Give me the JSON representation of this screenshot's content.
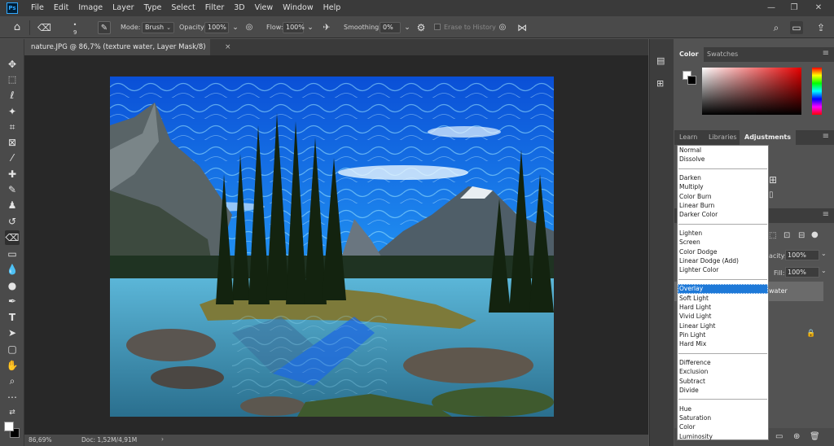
{
  "app": {
    "logo_text": "Ps"
  },
  "menu": [
    "File",
    "Edit",
    "Image",
    "Layer",
    "Type",
    "Select",
    "Filter",
    "3D",
    "View",
    "Window",
    "Help"
  ],
  "window_controls": {
    "minimize": "—",
    "restore": "❐",
    "close": "✕"
  },
  "options": {
    "brush_size": "9",
    "mode_label": "Mode:",
    "mode_value": "Brush",
    "opacity_label": "Opacity:",
    "opacity_value": "100%",
    "flow_label": "Flow:",
    "flow_value": "100%",
    "smoothing_label": "Smoothing:",
    "smoothing_value": "0%",
    "erase_history_label": "Erase to History"
  },
  "document": {
    "tab_title": "nature.JPG @ 86,7% (texture water, Layer Mask/8) *",
    "close_glyph": "×"
  },
  "status": {
    "zoom": "86,69%",
    "doc_info": "Doc: 1,52M/4,91M",
    "arrow": "›"
  },
  "panels": {
    "color_tabs": [
      "Color",
      "Swatches"
    ],
    "adjust_tabs": [
      "Learn",
      "Libraries",
      "Adjustments"
    ],
    "layers": {
      "opacity_label": "acity:",
      "opacity_value": "100%",
      "fill_label": "Fill:",
      "fill_value": "100%",
      "layer_name": "water"
    }
  },
  "blend_modes": [
    [
      "Normal",
      "Dissolve"
    ],
    [
      "Darken",
      "Multiply",
      "Color Burn",
      "Linear Burn",
      "Darker Color"
    ],
    [
      "Lighten",
      "Screen",
      "Color Dodge",
      "Linear Dodge (Add)",
      "Lighter Color"
    ],
    [
      "Overlay",
      "Soft Light",
      "Hard Light",
      "Vivid Light",
      "Linear Light",
      "Pin Light",
      "Hard Mix"
    ],
    [
      "Difference",
      "Exclusion",
      "Subtract",
      "Divide"
    ],
    [
      "Hue",
      "Saturation",
      "Color",
      "Luminosity"
    ]
  ],
  "selected_blend_mode": "Overlay",
  "colors": {
    "foreground": "#ffffff",
    "background": "#000000",
    "selection": "#1e79d8"
  }
}
